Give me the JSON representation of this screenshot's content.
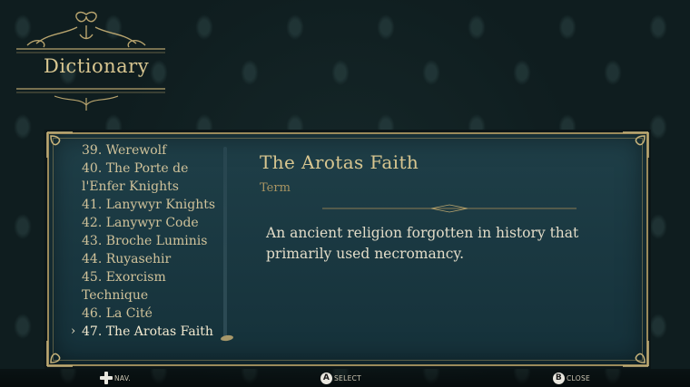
{
  "header": {
    "title": "Dictionary"
  },
  "list": {
    "items": [
      {
        "label": "39. Werewolf",
        "selected": false
      },
      {
        "label": "40. The Porte de",
        "selected": false
      },
      {
        "label": "l'Enfer Knights",
        "selected": false
      },
      {
        "label": "41. Lanywyr Knights",
        "selected": false
      },
      {
        "label": "42. Lanywyr Code",
        "selected": false
      },
      {
        "label": "43. Broche Luminis",
        "selected": false
      },
      {
        "label": "44. Ruyasehir",
        "selected": false
      },
      {
        "label": "45. Exorcism",
        "selected": false
      },
      {
        "label": "Technique",
        "selected": false
      },
      {
        "label": "46. La Cité",
        "selected": false
      },
      {
        "label": "47. The Arotas Faith",
        "selected": true
      }
    ],
    "selector_glyph": "›"
  },
  "entry": {
    "title": "The Arotas Faith",
    "type": "Term",
    "description": "An ancient religion forgotten in history that primarily used necromancy."
  },
  "footer": {
    "nav": {
      "icon": "dpad-icon",
      "label": "NAV."
    },
    "select": {
      "button": "A",
      "label": "SELECT"
    },
    "close": {
      "button": "B",
      "label": "CLOSE"
    }
  },
  "colors": {
    "gold": "#d8c690",
    "panel": "#1f3f48",
    "background": "#0f1d1f"
  }
}
